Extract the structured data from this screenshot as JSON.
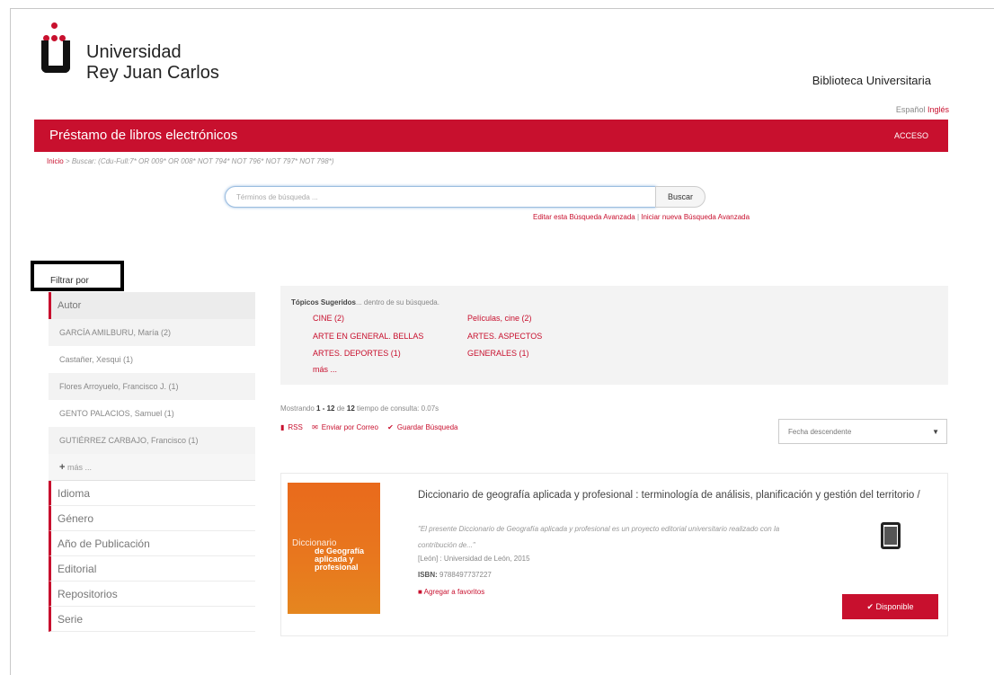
{
  "header": {
    "logo_line1": "Universidad",
    "logo_line2": "Rey Juan Carlos",
    "library": "Biblioteca Universitaria",
    "lang_es": "Español",
    "lang_en": "Inglés",
    "section_title": "Préstamo de libros electrónicos",
    "login": "ACCESO"
  },
  "breadcrumb": {
    "home": "Inicio",
    "separator": " > ",
    "current": "Buscar: (Cdu-Full:7* OR 009* OR 008* NOT 794* NOT 796* NOT 797* NOT 798*)"
  },
  "search": {
    "placeholder": "Términos de búsqueda ...",
    "button": "Buscar",
    "edit_advanced": "Editar esta Búsqueda Avanzada",
    "divider": " | ",
    "new_advanced": "Iniciar nueva Búsqueda Avanzada"
  },
  "sidebar": {
    "filter_label": "Filtrar por",
    "autor_label": "Autor",
    "authors": [
      "GARCÍA AMILBURU, María (2)",
      "Castañer, Xesqui (1)",
      "Flores Arroyuelo, Francisco J. (1)",
      "GENTO PALACIOS, Samuel (1)",
      "GUTIÉRREZ CARBAJO, Francisco (1)"
    ],
    "more": "más ...",
    "facets": [
      "Idioma",
      "Género",
      "Año de Publicación",
      "Editorial",
      "Repositorios",
      "Serie"
    ]
  },
  "topics": {
    "header_bold": "Tópicos Sugeridos",
    "header_rest": "... dentro de su búsqueda.",
    "items": [
      "CINE (2)",
      "Películas, cine (2)",
      "ARTE EN GENERAL. BELLAS",
      "ARTES. ASPECTOS",
      "ARTES. DEPORTES (1)",
      "GENERALES (1)",
      "más ..."
    ]
  },
  "results": {
    "showing": "Mostrando",
    "range": "1 - 12",
    "of": "de",
    "total": "12",
    "query_time": "tiempo de consulta: 0.07s",
    "rss": "RSS",
    "email": "Enviar por Correo",
    "save": "Guardar Búsqueda",
    "sort_selected": "Fecha descendente"
  },
  "record": {
    "title": "Diccionario de geografía aplicada y profesional : terminología de análisis, planificación y gestión del territorio /",
    "description": "\"El presente Diccionario de Geografía aplicada y profesional es un proyecto editorial universitario realizado con la contribución de...\"",
    "publisher": "[León] : Universidad de León, 2015",
    "isbn_label": "ISBN:",
    "isbn": "9788497737227",
    "favorite": "Agregar a favoritos",
    "cover_word": "Diccionario",
    "cover_sub": "de Geografía aplicada y profesional",
    "availability": "Disponible"
  },
  "colors": {
    "brand_red": "#c8102e",
    "cover_orange": "#e8781e"
  }
}
